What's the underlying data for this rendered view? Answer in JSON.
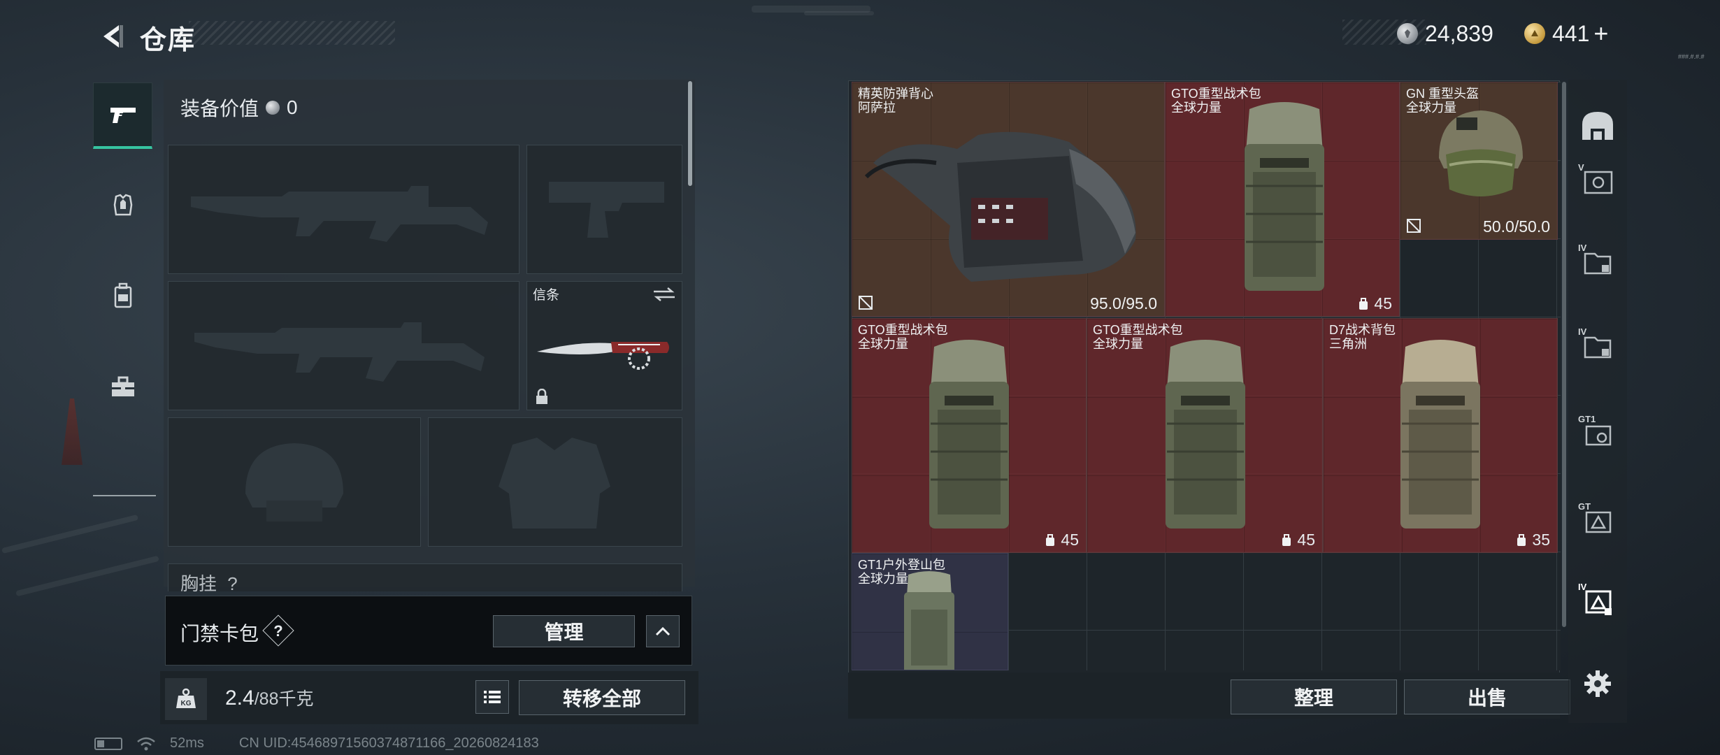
{
  "header": {
    "title": "仓库",
    "currency_silver": "24,839",
    "currency_gold": "441",
    "gold_plus": "+",
    "version_tiny": "###.#.#.#"
  },
  "left_nav": {
    "items": [
      {
        "name": "weapon",
        "icon": "pistol-icon",
        "active": true
      },
      {
        "name": "armor",
        "icon": "armor-vest-icon"
      },
      {
        "name": "backpack",
        "icon": "backpack-icon"
      },
      {
        "name": "supplies",
        "icon": "toolbox-icon"
      }
    ]
  },
  "equipment": {
    "value_label": "装备价值",
    "value": "0",
    "melee_label": "信条",
    "chest_label": "胸挂",
    "chest_help": "?"
  },
  "access_card": {
    "label": "门禁卡包",
    "help": "?",
    "manage_button": "管理"
  },
  "weight": {
    "current": "2.4",
    "max": "/88千克",
    "kg_icon": "KG",
    "transfer_all_button": "转移全部"
  },
  "footer": {
    "ping": "52ms",
    "uid": "CN UID:45468971560374871166_20260824183"
  },
  "stash_items": [
    {
      "name_line1": "精英防弹背心",
      "name_line2": "阿萨拉",
      "durability": "95.0/95.0",
      "color": "brown",
      "kind": "vest"
    },
    {
      "name_line1": "GTO重型战术包",
      "name_line2": "全球力量",
      "capacity": "45",
      "color": "red",
      "kind": "backpack"
    },
    {
      "name_line1": "GN 重型头盔",
      "name_line2": "全球力量",
      "durability": "50.0/50.0",
      "color": "brown",
      "kind": "helmet"
    },
    {
      "name_line1": "GTO重型战术包",
      "name_line2": "全球力量",
      "capacity": "45",
      "color": "red",
      "kind": "backpack"
    },
    {
      "name_line1": "GTO重型战术包",
      "name_line2": "全球力量",
      "capacity": "45",
      "color": "red",
      "kind": "backpack"
    },
    {
      "name_line1": "D7战术背包",
      "name_line2": "三角洲",
      "capacity": "35",
      "color": "red",
      "kind": "backpack-tan"
    },
    {
      "name_line1": "GT1户外登山包",
      "name_line2": "全球力量",
      "color": "purple",
      "kind": "backpack-small"
    }
  ],
  "stash_buttons": {
    "sort": "整理",
    "sell": "出售"
  },
  "right_tabs": [
    {
      "icon": "stash-arch-icon",
      "label": ""
    },
    {
      "icon": "case-v-icon",
      "label": "V"
    },
    {
      "icon": "case-iv-icon",
      "label": "IV"
    },
    {
      "icon": "case-iv-icon",
      "label": "IV"
    },
    {
      "icon": "case-gt1-icon",
      "label": "GT1"
    },
    {
      "icon": "case-gt-icon",
      "label": "GT"
    },
    {
      "icon": "case-iv-active-icon",
      "label": "IV"
    },
    {
      "icon": "gear-icon",
      "label": ""
    }
  ]
}
